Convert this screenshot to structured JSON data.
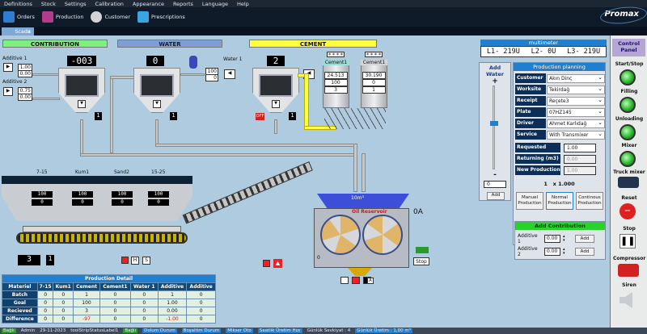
{
  "menu": [
    "Definitions",
    "Stock",
    "Settings",
    "Calibration",
    "Appearance",
    "Reports",
    "Language",
    "Help"
  ],
  "toolbar": {
    "orders": "Orders",
    "production": "Production",
    "customer": "Customer",
    "prescriptions": "Prescriptions",
    "logo": "Promax"
  },
  "tab": {
    "label": "Scada",
    "close": "x"
  },
  "sections": {
    "contribution": "CONTRIBUTION",
    "water": "WATER",
    "cement": "CEMENT"
  },
  "contribution": {
    "display": "-003",
    "additive1": "Additive 1",
    "additive1_vals": [
      "1.00",
      "0.00"
    ],
    "additive2": "Additive 2",
    "additive2_vals": [
      "0.75",
      "0.00"
    ],
    "indicator": "1"
  },
  "water": {
    "display": "0",
    "label": "Water 1",
    "vals": [
      "100",
      "0"
    ],
    "indicator": "1"
  },
  "cement": {
    "display": "2",
    "indicator": "1",
    "off": "OFF",
    "silo1": {
      "name": "Cement1",
      "values": [
        "24.513",
        "100",
        "3"
      ],
      "stars": "* * * *"
    },
    "silo2": {
      "name": "Cement1",
      "values": [
        "30.190",
        "0",
        "1"
      ],
      "stars": "* * * *"
    }
  },
  "aggregates": {
    "labels": [
      "7-15",
      "Kum1",
      "Sand2",
      "15-25"
    ],
    "targets": [
      "100",
      "100",
      "100",
      "100"
    ],
    "actuals": [
      "0",
      "0",
      "0",
      "0"
    ],
    "display": "3",
    "indicator": "1",
    "h": "H",
    "s": "S"
  },
  "mixer": {
    "volume": "10m³",
    "status": "Oil Reservoir",
    "mode": "0A",
    "zero": "0",
    "a_label": "A",
    "stop": "Stop"
  },
  "detail": {
    "title": "Production Detail",
    "headers": [
      "Materiel",
      "7-15",
      "Kum1",
      "Cement",
      "Cement1",
      "Water 1",
      "Additive",
      "Additive"
    ],
    "rows": [
      [
        "Batch",
        "0",
        "0",
        "1",
        "0",
        "0",
        "1",
        "0"
      ],
      [
        "Goal",
        "0",
        "0",
        "100",
        "0",
        "0",
        "1.00",
        "0"
      ],
      [
        "Recieved",
        "0",
        "0",
        "3",
        "0",
        "0",
        "0.00",
        "0"
      ],
      [
        "Difference",
        "0",
        "0",
        "-97",
        "0",
        "0",
        "-1.00",
        "0"
      ]
    ]
  },
  "multimeter": {
    "title": "multimeter",
    "l1": "L1- 219U",
    "l2": "L2- 0U",
    "l3": "L3- 219U"
  },
  "add_water": {
    "title": "Add Water",
    "plus": "+",
    "minus": "-",
    "value": "0",
    "button": "Add"
  },
  "planning": {
    "title": "Production planning",
    "fields": [
      {
        "label": "Customer",
        "value": "Akın Dinç"
      },
      {
        "label": "Worksite",
        "value": "Tekirdağ"
      },
      {
        "label": "Receipt",
        "value": "Reçete3"
      },
      {
        "label": "Plate",
        "value": "07HZ145"
      },
      {
        "label": "Driver",
        "value": "Ahmet Karlıdağ"
      },
      {
        "label": "Service",
        "value": "With Transmixer"
      }
    ],
    "requested_label": "Requested",
    "requested": "1.00",
    "returning_label": "Returning (m3)",
    "returning": "0.00",
    "new_label": "New Production",
    "new": "1.00",
    "count": "1   x 1.000",
    "buttons": [
      "Manuel Production",
      "Normal Production",
      "Continous Production"
    ]
  },
  "add_contribution": {
    "title": "Add Contribution",
    "rows": [
      {
        "label": "Additive 1",
        "value": "0.00",
        "button": "Add"
      },
      {
        "label": "Additive 2",
        "value": "0.00",
        "button": "Add"
      }
    ]
  },
  "control": {
    "title": "Control Panel",
    "items": [
      "Start/Stop",
      "Filling",
      "Unloading",
      "Mixer",
      "Truck mixer",
      "Reset",
      "Stop",
      "Compressor",
      "Siren"
    ]
  },
  "status": [
    "Bağlı",
    "Admin",
    "29-11-2023",
    "toolStripStatusLabel1",
    "Bağlı",
    "Dolum Durum",
    "Boşaltim Durum",
    "Mikser Oto",
    "Saatlik Üretim Hızı",
    "Günlük Sevkiyat : 4",
    "Günlük Üretim : 1,00 m³"
  ],
  "colors": {
    "accent": "#7b9fd1",
    "ok": "#2bb52b",
    "warn": "#ff2a2a",
    "panel": "#b6a6d8"
  }
}
